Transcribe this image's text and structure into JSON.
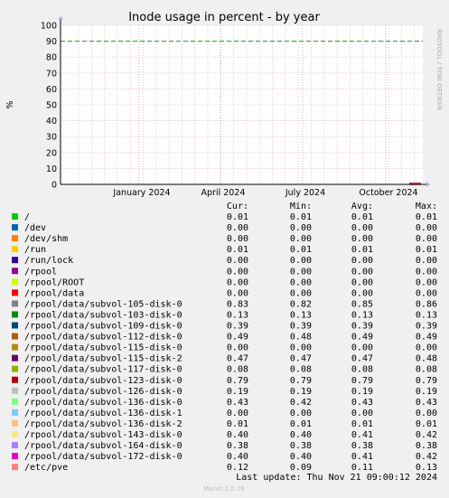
{
  "chart_data": {
    "type": "line",
    "title": "Inode usage in percent - by year",
    "ylabel": "%",
    "ylim": [
      0,
      100
    ],
    "yticks": [
      0,
      10,
      20,
      30,
      40,
      50,
      60,
      70,
      80,
      90,
      100
    ],
    "xticks": [
      "January 2024",
      "April 2024",
      "July 2024",
      "October 2024"
    ],
    "grid": true,
    "warning_line": 90,
    "watermark": "RRDTOOL / TOBI OETIKER",
    "columns": [
      "Cur:",
      "Min:",
      "Avg:",
      "Max:"
    ],
    "series": [
      {
        "name": "/",
        "color": "#00cc00",
        "cur": "0.01",
        "min": "0.01",
        "avg": "0.01",
        "max": "0.01"
      },
      {
        "name": "/dev",
        "color": "#0066b3",
        "cur": "0.00",
        "min": "0.00",
        "avg": "0.00",
        "max": "0.00"
      },
      {
        "name": "/dev/shm",
        "color": "#ff8000",
        "cur": "0.00",
        "min": "0.00",
        "avg": "0.00",
        "max": "0.00"
      },
      {
        "name": "/run",
        "color": "#ffcc00",
        "cur": "0.01",
        "min": "0.01",
        "avg": "0.01",
        "max": "0.01"
      },
      {
        "name": "/run/lock",
        "color": "#330099",
        "cur": "0.00",
        "min": "0.00",
        "avg": "0.00",
        "max": "0.00"
      },
      {
        "name": "/rpool",
        "color": "#990099",
        "cur": "0.00",
        "min": "0.00",
        "avg": "0.00",
        "max": "0.00"
      },
      {
        "name": "/rpool/ROOT",
        "color": "#ccff00",
        "cur": "0.00",
        "min": "0.00",
        "avg": "0.00",
        "max": "0.00"
      },
      {
        "name": "/rpool/data",
        "color": "#ff0000",
        "cur": "0.00",
        "min": "0.00",
        "avg": "0.00",
        "max": "0.00"
      },
      {
        "name": "/rpool/data/subvol-105-disk-0",
        "color": "#808080",
        "cur": "0.83",
        "min": "0.82",
        "avg": "0.85",
        "max": "0.86"
      },
      {
        "name": "/rpool/data/subvol-103-disk-0",
        "color": "#008f00",
        "cur": "0.13",
        "min": "0.13",
        "avg": "0.13",
        "max": "0.13"
      },
      {
        "name": "/rpool/data/subvol-109-disk-0",
        "color": "#00487d",
        "cur": "0.39",
        "min": "0.39",
        "avg": "0.39",
        "max": "0.39"
      },
      {
        "name": "/rpool/data/subvol-112-disk-0",
        "color": "#b35a00",
        "cur": "0.49",
        "min": "0.48",
        "avg": "0.49",
        "max": "0.49"
      },
      {
        "name": "/rpool/data/subvol-115-disk-0",
        "color": "#b38f00",
        "cur": "0.00",
        "min": "0.00",
        "avg": "0.00",
        "max": "0.00"
      },
      {
        "name": "/rpool/data/subvol-115-disk-2",
        "color": "#6b006b",
        "cur": "0.47",
        "min": "0.47",
        "avg": "0.47",
        "max": "0.48"
      },
      {
        "name": "/rpool/data/subvol-117-disk-0",
        "color": "#8fb300",
        "cur": "0.08",
        "min": "0.08",
        "avg": "0.08",
        "max": "0.08"
      },
      {
        "name": "/rpool/data/subvol-123-disk-0",
        "color": "#b30000",
        "cur": "0.79",
        "min": "0.79",
        "avg": "0.79",
        "max": "0.79"
      },
      {
        "name": "/rpool/data/subvol-126-disk-0",
        "color": "#bebebe",
        "cur": "0.19",
        "min": "0.19",
        "avg": "0.19",
        "max": "0.19"
      },
      {
        "name": "/rpool/data/subvol-136-disk-0",
        "color": "#80ff80",
        "cur": "0.43",
        "min": "0.42",
        "avg": "0.43",
        "max": "0.43"
      },
      {
        "name": "/rpool/data/subvol-136-disk-1",
        "color": "#80c9ff",
        "cur": "0.00",
        "min": "0.00",
        "avg": "0.00",
        "max": "0.00"
      },
      {
        "name": "/rpool/data/subvol-136-disk-2",
        "color": "#ffc080",
        "cur": "0.01",
        "min": "0.01",
        "avg": "0.01",
        "max": "0.01"
      },
      {
        "name": "/rpool/data/subvol-143-disk-0",
        "color": "#ffe680",
        "cur": "0.40",
        "min": "0.40",
        "avg": "0.41",
        "max": "0.42"
      },
      {
        "name": "/rpool/data/subvol-164-disk-0",
        "color": "#aa80ff",
        "cur": "0.38",
        "min": "0.38",
        "avg": "0.38",
        "max": "0.38"
      },
      {
        "name": "/rpool/data/subvol-172-disk-0",
        "color": "#ee00cc",
        "cur": "0.40",
        "min": "0.40",
        "avg": "0.41",
        "max": "0.42"
      },
      {
        "name": "/etc/pve",
        "color": "#ff8080",
        "cur": "0.12",
        "min": "0.09",
        "avg": "0.11",
        "max": "0.13"
      }
    ],
    "last_update": "Last update: Thu Nov 21 09:00:12 2024",
    "footer": "Munin 2.0.76"
  }
}
